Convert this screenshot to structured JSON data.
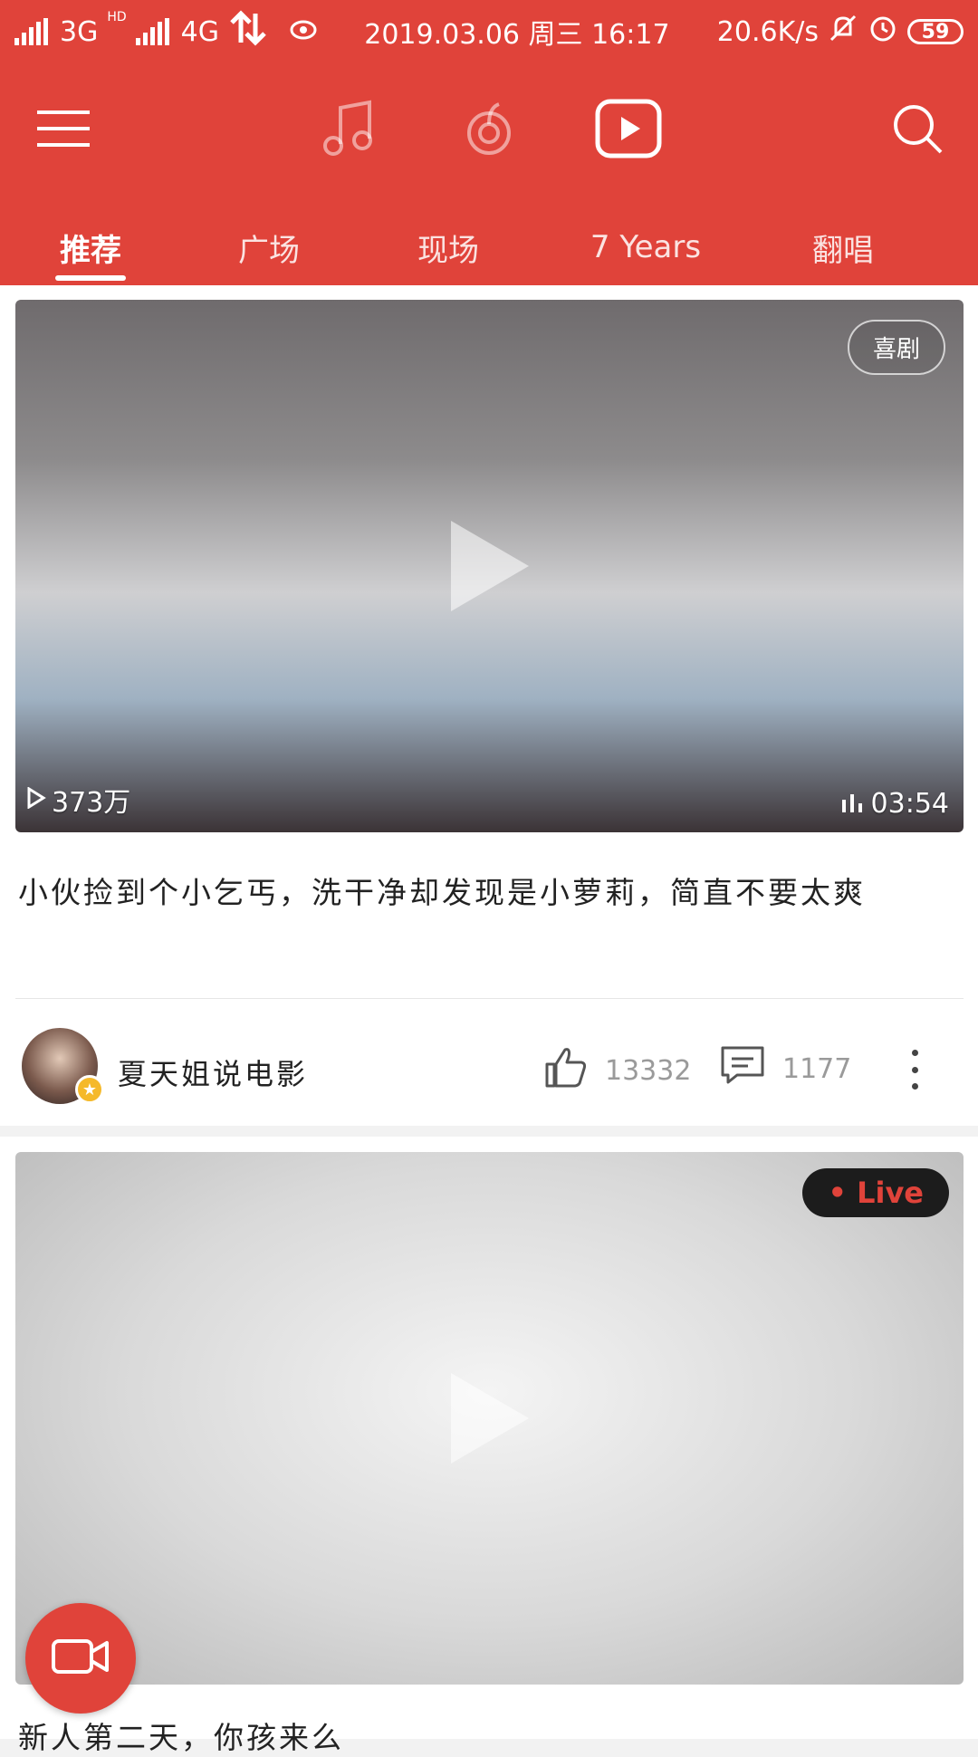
{
  "status_bar": {
    "net_3g": "3G",
    "net_4g": "4G",
    "hd": "HD",
    "datetime": "2019.03.06 周三 16:17",
    "speed": "20.6K/s",
    "battery": "59"
  },
  "header": {
    "icons": [
      "menu-icon",
      "music-icon",
      "radio-icon",
      "video-icon",
      "search-icon"
    ]
  },
  "tabs": [
    {
      "label": "推荐",
      "active": true
    },
    {
      "label": "广场",
      "active": false
    },
    {
      "label": "现场",
      "active": false
    },
    {
      "label": "7 Years",
      "active": false
    },
    {
      "label": "翻唱",
      "active": false
    }
  ],
  "feed": [
    {
      "genre_badge": "喜剧",
      "play_count": "373万",
      "duration": "03:54",
      "title": "小伙捡到个小乞丐，洗干净却发现是小萝莉，简直不要太爽",
      "author": "夏天姐说电影",
      "likes": "13332",
      "comments": "1177"
    },
    {
      "live_badge": "• Live",
      "title": "新人第二天，你孩来么"
    }
  ],
  "colors": {
    "brand": "#e0433a",
    "live_text": "#e0433a",
    "avatar_badge": "#f5b92a"
  }
}
